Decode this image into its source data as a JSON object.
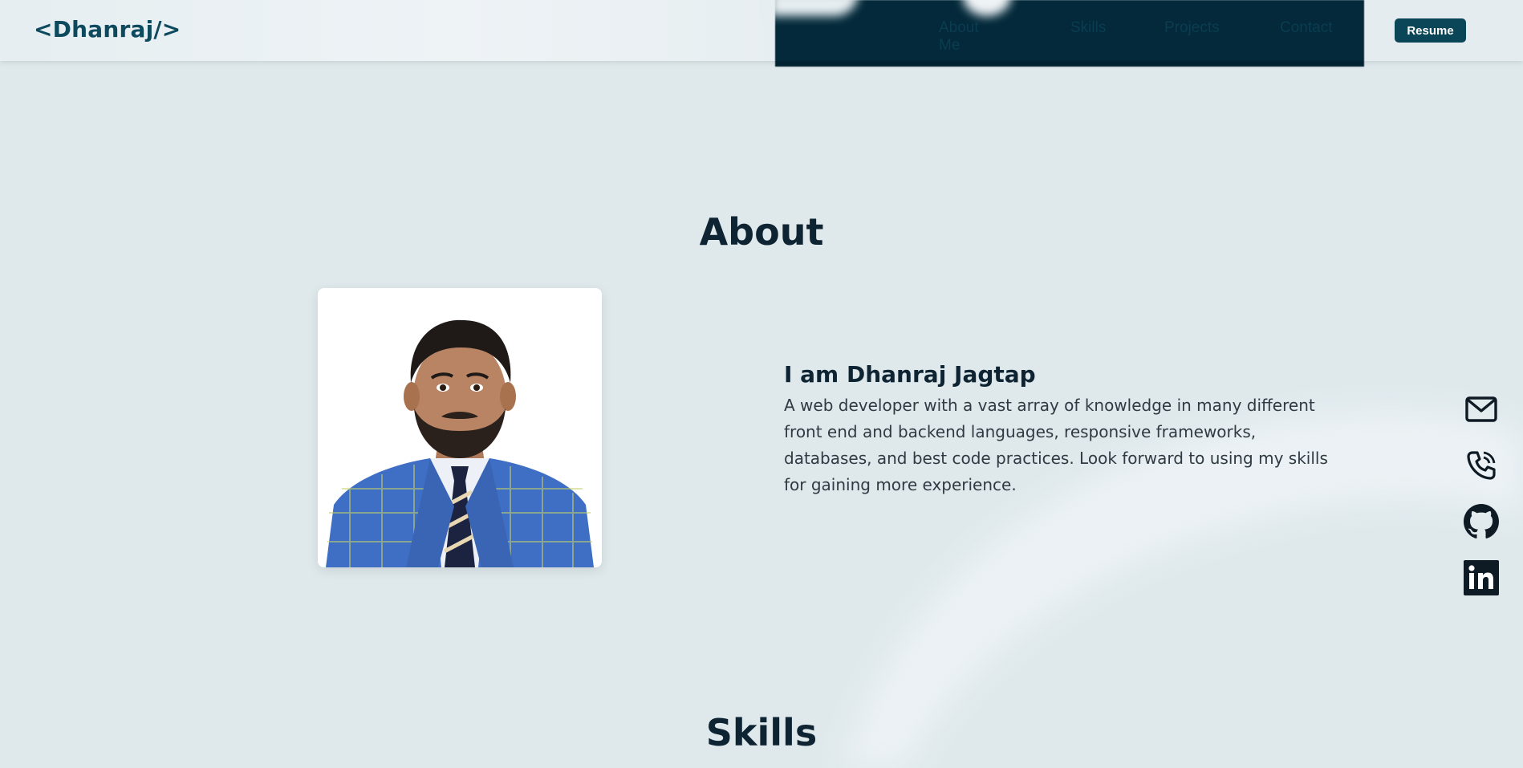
{
  "header": {
    "logo": "<Dhanraj/>",
    "nav": [
      "About Me",
      "Skills",
      "Projects",
      "Contact"
    ],
    "resume_label": "Resume"
  },
  "about": {
    "title": "About",
    "name": "I am Dhanraj Jagtap",
    "description": "A web developer with a vast array of knowledge in many different front end and backend languages, responsive frameworks, databases, and best code practices. Look forward to using my skills for gaining more experience."
  },
  "skills": {
    "title": "Skills"
  },
  "social": {
    "icons": [
      "mail-icon",
      "phone-icon",
      "github-icon",
      "linkedin-icon"
    ]
  },
  "colors": {
    "background": "#dfe9ec",
    "brand": "#0d4a5e",
    "nav_dark": "#03293a",
    "heading": "#0e2433"
  }
}
